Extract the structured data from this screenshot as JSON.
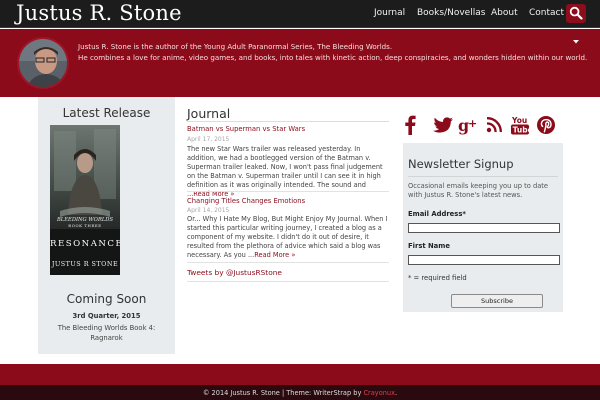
{
  "header": {
    "site_title": "Justus R. Stone",
    "nav": [
      "Journal",
      "Books/Novellas",
      "About",
      "Contact"
    ],
    "search_icon": "search-icon",
    "colors": {
      "bar": "#1c1c1c",
      "accent": "#8b0b1a"
    }
  },
  "banner": {
    "bio_line1": "Justus R. Stone is the author of the Young Adult Paranormal Series, The Bleeding Worlds.",
    "bio_line2": "He combines a love for anime, video games, and books, into tales with kinetic action, deep conspiracies, and wonders hidden within our world."
  },
  "latest_release": {
    "heading": "Latest Release",
    "cover": {
      "series": "BLEEDING WORLDS",
      "subtitle": "BOOK THREE",
      "title": "RESONANCE",
      "author": "JUSTUS R STONE"
    }
  },
  "coming_soon": {
    "heading": "Coming Soon",
    "date": "3rd Quarter, 2015",
    "description": "The Bleeding Worlds Book 4: Ragnarok"
  },
  "journal": {
    "heading": "Journal",
    "posts": [
      {
        "title": "Batman vs Superman vs Star Wars",
        "date": "April 17, 2015",
        "excerpt": "The new Star Wars trailer was released yesterday. In addition, we had a bootlegged version of the Batman v. Superman trailer leaked. Now, I won't pass final judgement on the Batman v. Superman trailer until I can see it in high definition as it was originally intended. The sound and ...",
        "read_more": "Read More »"
      },
      {
        "title": "Changing Titles Changes Emotions",
        "date": "April 14, 2015",
        "excerpt": "Or... Why I Hate My Blog, But Might Enjoy My Journal. When I started this particular writing journey, I created a blog as a component of my website. I didn't do it out of desire, it resulted from the plethora of advice which said a blog was necessary. As you ...",
        "read_more": "Read More »"
      }
    ],
    "tweets_link": "Tweets by @JustusRStone"
  },
  "social": [
    "facebook-icon",
    "twitter-icon",
    "google-plus-icon",
    "rss-icon",
    "youtube-icon",
    "pinterest-icon"
  ],
  "newsletter": {
    "heading": "Newsletter Signup",
    "description": "Occasional emails keeping you up to date with Justus R. Stone's latest news.",
    "email_label": "Email Address*",
    "email_value": "",
    "name_label": "First Name",
    "name_value": "",
    "required_note": "* = required field",
    "submit_label": "Subscribe"
  },
  "footer": {
    "copyright": "© 2014 Justus R. Stone | Theme: WriterStrap by ",
    "credit_link": "Crayonux",
    "end": "."
  }
}
